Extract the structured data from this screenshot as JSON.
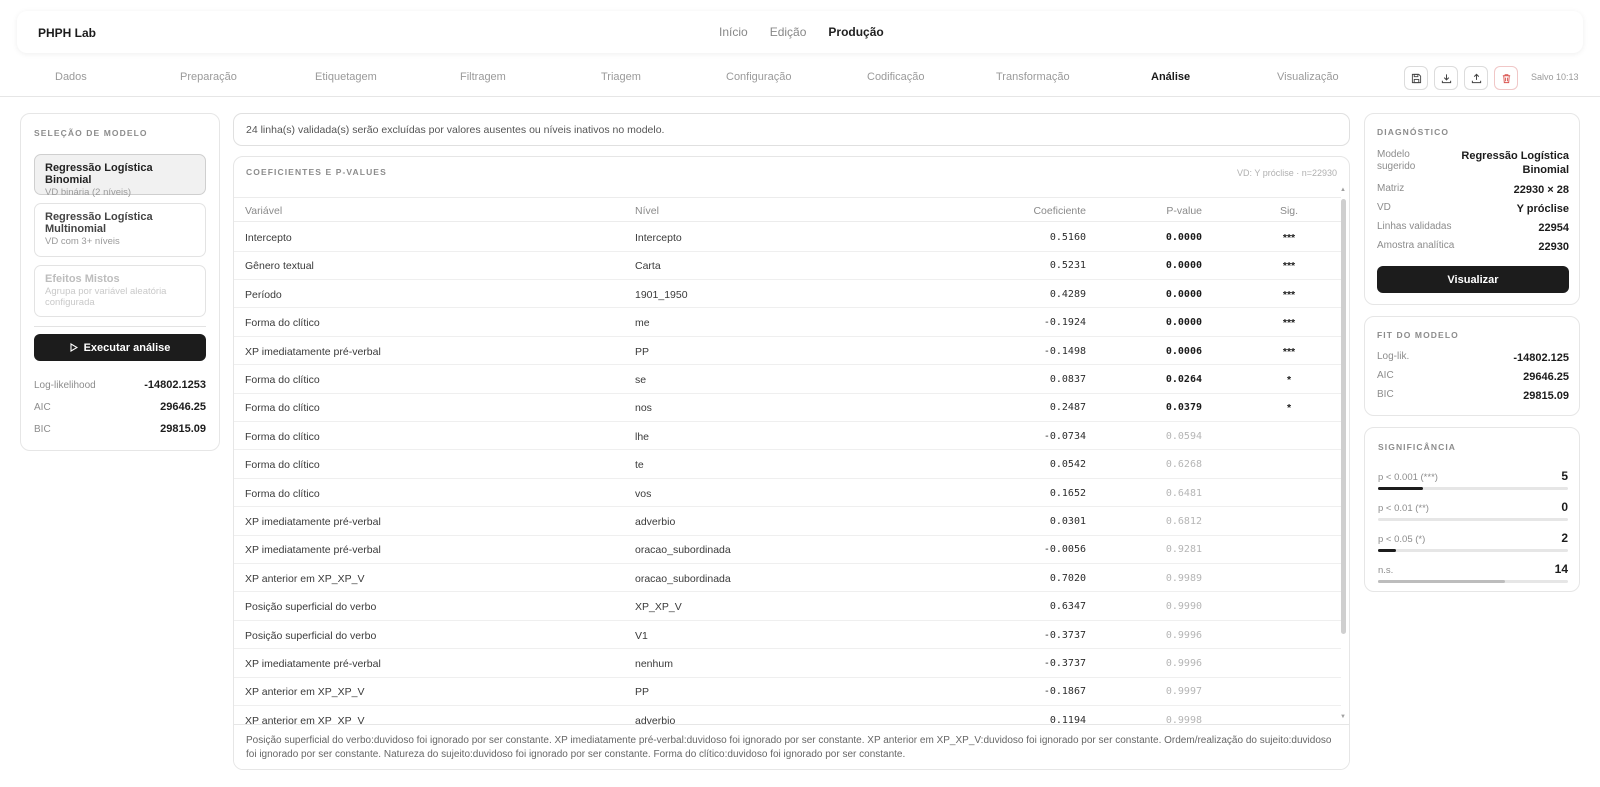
{
  "app": {
    "brand": "PHPH Lab"
  },
  "topnav": [
    {
      "label": "Início",
      "active": false
    },
    {
      "label": "Edição",
      "active": false
    },
    {
      "label": "Produção",
      "active": true
    }
  ],
  "steps": [
    {
      "label": "Dados",
      "active": false
    },
    {
      "label": "Preparação",
      "active": false
    },
    {
      "label": "Etiquetagem",
      "active": false
    },
    {
      "label": "Filtragem",
      "active": false
    },
    {
      "label": "Triagem",
      "active": false
    },
    {
      "label": "Configuração",
      "active": false
    },
    {
      "label": "Codificação",
      "active": false
    },
    {
      "label": "Transformação",
      "active": false
    },
    {
      "label": "Análise",
      "active": true
    },
    {
      "label": "Visualização",
      "active": false
    }
  ],
  "toolbar": {
    "icons": [
      "save-icon",
      "download-icon",
      "upload-icon",
      "trash-icon"
    ],
    "saved": "Salvo 10:13"
  },
  "model_selection": {
    "title": "SELEÇÃO DE MODELO",
    "options": [
      {
        "title": "Regressão Logística Binomial",
        "subtitle": "VD binária (2 níveis)",
        "state": "selected"
      },
      {
        "title": "Regressão Logística Multinomial",
        "subtitle": "VD com 3+ níveis",
        "state": "available"
      },
      {
        "title": "Efeitos Mistos",
        "subtitle": "Agrupa por variável aleatória configurada",
        "state": "disabled"
      }
    ],
    "run_label": "Executar análise",
    "stats": [
      {
        "key": "Log-likelihood",
        "value": "-14802.1253"
      },
      {
        "key": "AIC",
        "value": "29646.25"
      },
      {
        "key": "BIC",
        "value": "29815.09"
      }
    ]
  },
  "notice": "24 linha(s) validada(s) serão excluídas por valores ausentes ou níveis inativos no modelo.",
  "coef_table": {
    "title": "COEFICIENTES E P-VALUES",
    "info": "VD: Y próclise · n=22930",
    "columns": {
      "variavel": "Variável",
      "nivel": "Nível",
      "coeficiente": "Coeficiente",
      "pvalue": "P-value",
      "sig": "Sig."
    },
    "rows": [
      {
        "variavel": "Intercepto",
        "nivel": "Intercepto",
        "coeficiente": "0.5160",
        "pvalue": "0.0000",
        "sig": "***"
      },
      {
        "variavel": "Gênero textual",
        "nivel": "Carta",
        "coeficiente": "0.5231",
        "pvalue": "0.0000",
        "sig": "***"
      },
      {
        "variavel": "Período",
        "nivel": "1901_1950",
        "coeficiente": "0.4289",
        "pvalue": "0.0000",
        "sig": "***"
      },
      {
        "variavel": "Forma do clítico",
        "nivel": "me",
        "coeficiente": "-0.1924",
        "pvalue": "0.0000",
        "sig": "***"
      },
      {
        "variavel": "XP imediatamente pré-verbal",
        "nivel": "PP",
        "coeficiente": "-0.1498",
        "pvalue": "0.0006",
        "sig": "***"
      },
      {
        "variavel": "Forma do clítico",
        "nivel": "se",
        "coeficiente": "0.0837",
        "pvalue": "0.0264",
        "sig": "*"
      },
      {
        "variavel": "Forma do clítico",
        "nivel": "nos",
        "coeficiente": "0.2487",
        "pvalue": "0.0379",
        "sig": "*"
      },
      {
        "variavel": "Forma do clítico",
        "nivel": "lhe",
        "coeficiente": "-0.0734",
        "pvalue": "0.0594",
        "sig": ""
      },
      {
        "variavel": "Forma do clítico",
        "nivel": "te",
        "coeficiente": "0.0542",
        "pvalue": "0.6268",
        "sig": ""
      },
      {
        "variavel": "Forma do clítico",
        "nivel": "vos",
        "coeficiente": "0.1652",
        "pvalue": "0.6481",
        "sig": ""
      },
      {
        "variavel": "XP imediatamente pré-verbal",
        "nivel": "adverbio",
        "coeficiente": "0.0301",
        "pvalue": "0.6812",
        "sig": ""
      },
      {
        "variavel": "XP imediatamente pré-verbal",
        "nivel": "oracao_subordinada",
        "coeficiente": "-0.0056",
        "pvalue": "0.9281",
        "sig": ""
      },
      {
        "variavel": "XP anterior em XP_XP_V",
        "nivel": "oracao_subordinada",
        "coeficiente": "0.7020",
        "pvalue": "0.9989",
        "sig": ""
      },
      {
        "variavel": "Posição superficial do verbo",
        "nivel": "XP_XP_V",
        "coeficiente": "0.6347",
        "pvalue": "0.9990",
        "sig": ""
      },
      {
        "variavel": "Posição superficial do verbo",
        "nivel": "V1",
        "coeficiente": "-0.3737",
        "pvalue": "0.9996",
        "sig": ""
      },
      {
        "variavel": "XP imediatamente pré-verbal",
        "nivel": "nenhum",
        "coeficiente": "-0.3737",
        "pvalue": "0.9996",
        "sig": ""
      },
      {
        "variavel": "XP anterior em XP_XP_V",
        "nivel": "PP",
        "coeficiente": "-0.1867",
        "pvalue": "0.9997",
        "sig": ""
      },
      {
        "variavel": "XP anterior em XP_XP_V",
        "nivel": "adverbio",
        "coeficiente": "0.1194",
        "pvalue": "0.9998",
        "sig": ""
      }
    ],
    "footnote": "Posição superficial do verbo:duvidoso foi ignorado por ser constante. XP imediatamente pré-verbal:duvidoso foi ignorado por ser constante. XP anterior em XP_XP_V:duvidoso foi ignorado por ser constante. Ordem/realização do sujeito:duvidoso foi ignorado por ser constante. Natureza do sujeito:duvidoso foi ignorado por ser constante. Forma do clítico:duvidoso foi ignorado por ser constante."
  },
  "diagnostico": {
    "title": "DIAGNÓSTICO",
    "model_key": "Modelo sugerido",
    "model_value": "Regressão Logística Binomial",
    "items": [
      {
        "key": "Matriz",
        "value": "22930 × 28"
      },
      {
        "key": "VD",
        "value": "Y próclise"
      },
      {
        "key": "Linhas validadas",
        "value": "22954"
      },
      {
        "key": "Amostra analítica",
        "value": "22930"
      }
    ],
    "button": "Visualizar"
  },
  "fit": {
    "title": "FIT DO MODELO",
    "items": [
      {
        "key": "Log-lik.",
        "value": "-14802.125"
      },
      {
        "key": "AIC",
        "value": "29646.25"
      },
      {
        "key": "BIC",
        "value": "29815.09"
      }
    ]
  },
  "significancia": {
    "title": "SIGNIFICÂNCIA",
    "items": [
      {
        "key": "p < 0.001 (***)",
        "value": "5",
        "fraction": 0.238
      },
      {
        "key": "p < 0.01 (**)",
        "value": "0",
        "fraction": 0
      },
      {
        "key": "p < 0.05 (*)",
        "value": "2",
        "fraction": 0.095
      },
      {
        "key": "n.s.",
        "value": "14",
        "fraction": 0.667
      }
    ]
  }
}
